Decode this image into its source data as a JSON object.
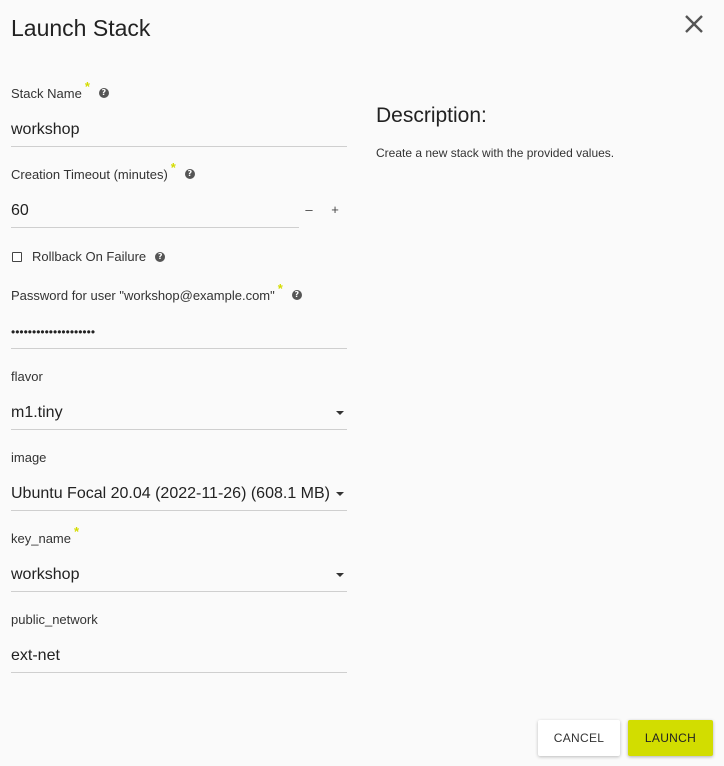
{
  "dialog": {
    "title": "Launch Stack",
    "close_icon": "close-icon"
  },
  "fields": {
    "stack_name": {
      "label": "Stack Name",
      "required_mark": "*",
      "help": "?",
      "value": "workshop"
    },
    "creation_timeout": {
      "label": "Creation Timeout (minutes)",
      "required_mark": "*",
      "help": "?",
      "value": "60",
      "decrement": "–",
      "increment": "+"
    },
    "rollback": {
      "label": "Rollback On Failure",
      "help": "?",
      "checked": false
    },
    "password": {
      "label": "Password for user \"workshop@example.com\"",
      "required_mark": "*",
      "help": "?",
      "value": "••••••••••••••••••••"
    },
    "flavor": {
      "label": "flavor",
      "value": "m1.tiny"
    },
    "image": {
      "label": "image",
      "value": "Ubuntu Focal 20.04 (2022-11-26) (608.1 MB)"
    },
    "key_name": {
      "label": "key_name",
      "required_mark": "*",
      "value": "workshop"
    },
    "public_network": {
      "label": "public_network",
      "value": "ext-net"
    }
  },
  "description": {
    "title": "Description:",
    "text": "Create a new stack with the provided values."
  },
  "actions": {
    "cancel_label": "CANCEL",
    "launch_label": "LAUNCH"
  },
  "colors": {
    "accent": "#d2dd00",
    "background": "#fafafa"
  }
}
